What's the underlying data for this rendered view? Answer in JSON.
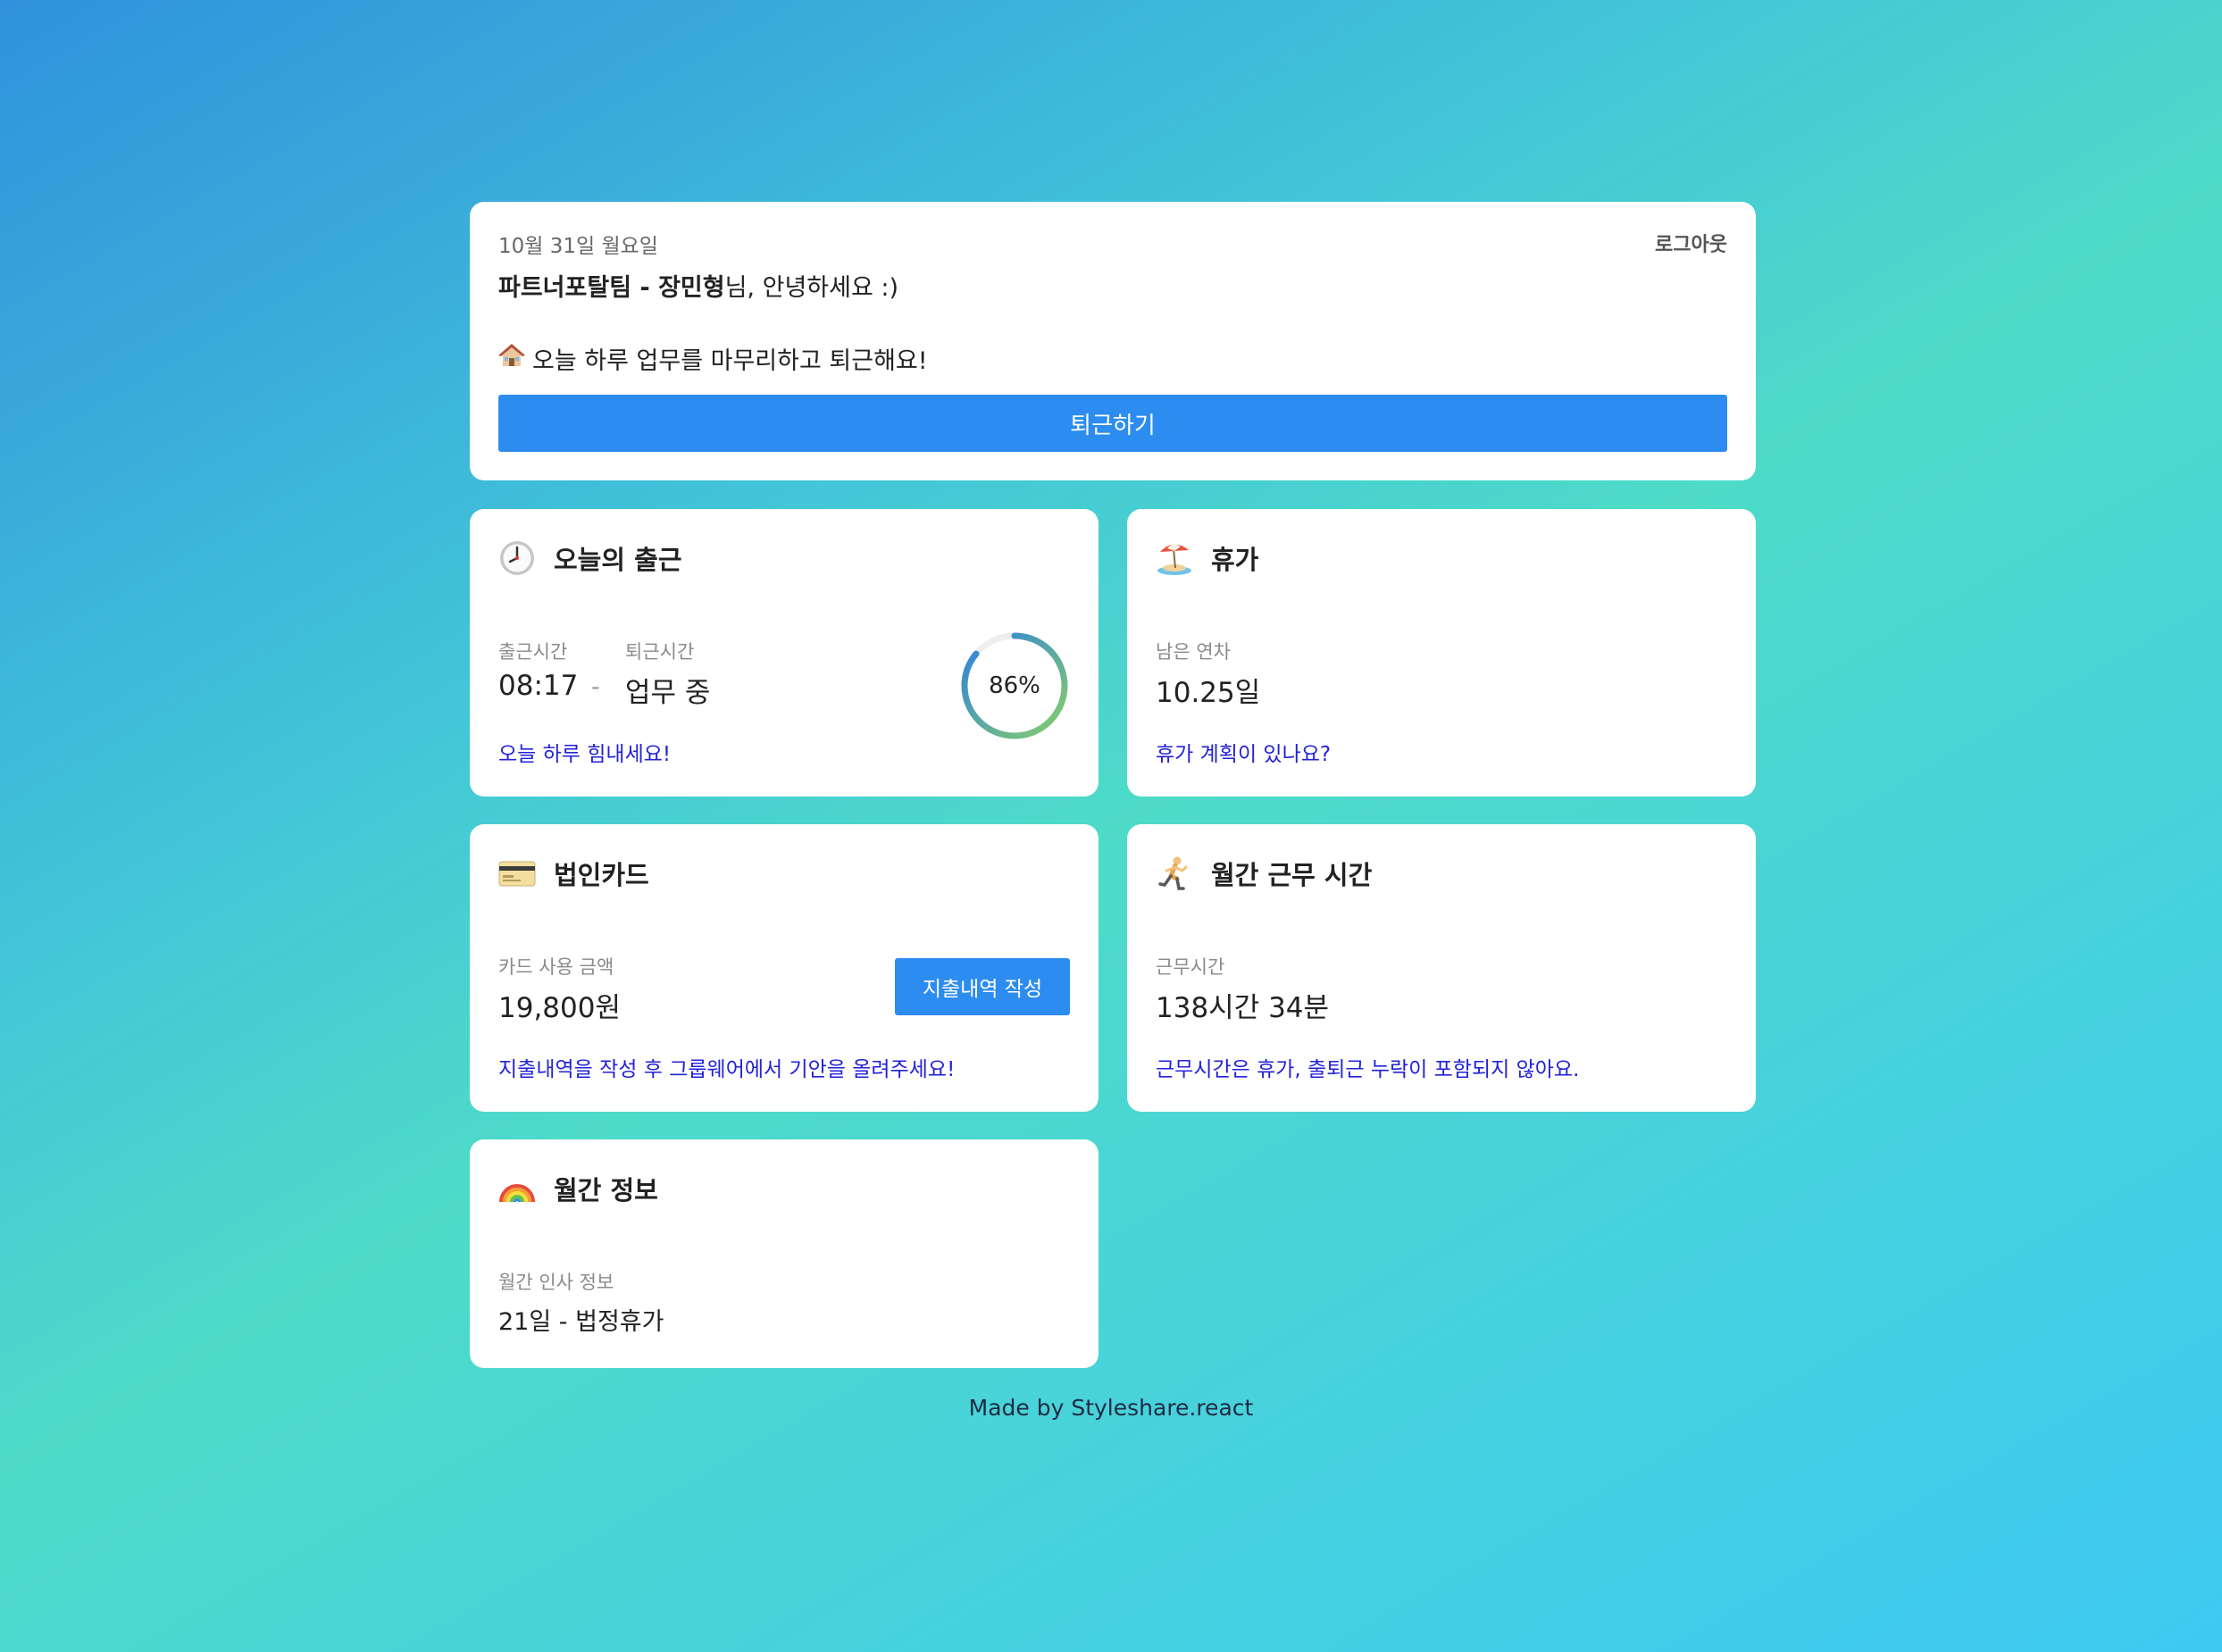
{
  "header": {
    "date": "10월 31일 월요일",
    "logout_label": "로그아웃",
    "team": "파트너포탈팀",
    "separator": " - ",
    "user_name": "장민형",
    "greeting_suffix": "님, 안녕하세요 :)",
    "message": "오늘 하루 업무를 마무리하고 퇴근해요!",
    "leave_button": "퇴근하기"
  },
  "commute": {
    "title": "오늘의 출근",
    "start_label": "출근시간",
    "end_label": "퇴근시간",
    "start_value": "08:17",
    "dash": "-",
    "end_value": "업무 중",
    "progress_text": "86%",
    "progress": 0.86,
    "note": "오늘 하루 힘내세요!"
  },
  "vacation": {
    "title": "휴가",
    "label": "남은 연차",
    "value": "10.25일",
    "note": "휴가 계획이 있나요?"
  },
  "corp_card": {
    "title": "법인카드",
    "label": "카드 사용 금액",
    "value": "19,800원",
    "button": "지출내역 작성",
    "note": "지출내역을 작성 후 그룹웨어에서 기안을 올려주세요!"
  },
  "work_time": {
    "title": "월간 근무 시간",
    "label": "근무시간",
    "value": "138시간 34분",
    "note": "근무시간은 휴가, 출퇴근 누락이 포함되지 않아요."
  },
  "monthly": {
    "title": "월간 정보",
    "label": "월간 인사 정보",
    "value": "21일 - 법정휴가"
  },
  "footer": "Made by Styleshare.react",
  "icons": {
    "house": "house-icon",
    "clock": "clock-icon",
    "beach": "beach-umbrella-icon",
    "card": "credit-card-icon",
    "runner": "runner-icon",
    "rainbow": "rainbow-icon"
  },
  "colors": {
    "primary": "#2d8cf0",
    "note": "#2222d8",
    "ring_start": "#86d06a",
    "ring_end": "#2d7fe0"
  }
}
